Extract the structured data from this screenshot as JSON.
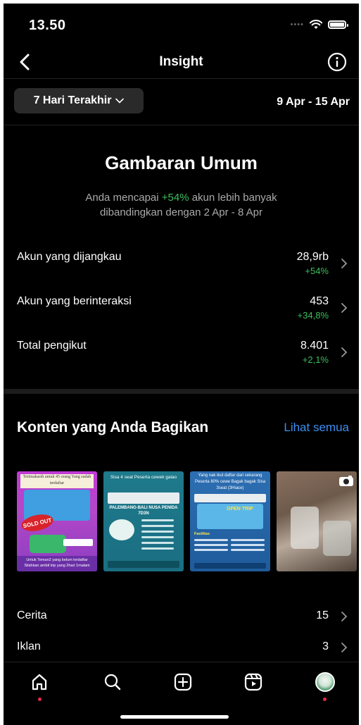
{
  "status_bar": {
    "time": "13.50"
  },
  "nav": {
    "title": "Insight"
  },
  "filter": {
    "range_label": "7 Hari Terakhir",
    "date_range": "9 Apr - 15 Apr"
  },
  "overview": {
    "title": "Gambaran Umum",
    "summary_prefix": "Anda mencapai ",
    "summary_highlight": "+54%",
    "summary_suffix": " akun lebih banyak",
    "summary_line2": "dibandingkan dengan 2 Apr - 8 Apr",
    "metrics": [
      {
        "label": "Akun yang dijangkau",
        "value": "28,9rb",
        "change": "+54%"
      },
      {
        "label": "Akun yang berinteraksi",
        "value": "453",
        "change": "+34,8%"
      },
      {
        "label": "Total pengikut",
        "value": "8.401",
        "change": "+2,1%"
      }
    ]
  },
  "content": {
    "title": "Konten yang Anda Bagikan",
    "see_all": "Lihat semua",
    "thumbnails": [
      {
        "top_text": "Terimakasih untuk 45 orang Yang sudah terdaftar",
        "badge": "SOLD OUT",
        "bottom_text": "Untuk Teman2 yang belum terdaftar Silahkan ambil trip yang 2hari 1malam"
      },
      {
        "top_text": "Sisa 4 seat Peserta cewek galao",
        "headline": "PALEMBANG-BALI NUSA PENIDA 7D3N"
      },
      {
        "top_text": "Yang nak ikut daftar dari sekarang Peserta 80% cewe Bagak bagak Sisa 3seat (3Hiace)",
        "headline": "OPEN TRIP",
        "sub": "Fasilitas"
      },
      {
        "top_text": ""
      }
    ],
    "rows": [
      {
        "label": "Cerita",
        "value": "15"
      },
      {
        "label": "Iklan",
        "value": "3"
      }
    ]
  },
  "colors": {
    "accent_green": "#3bbf5c",
    "link_blue": "#3d8ef0",
    "notification": "#e8294a"
  },
  "tabbar": {
    "icons": [
      "home-icon",
      "search-icon",
      "create-icon",
      "reels-icon",
      "profile-avatar"
    ]
  }
}
